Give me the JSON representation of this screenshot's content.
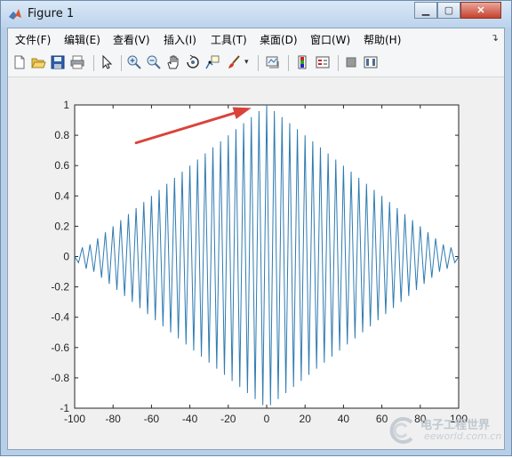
{
  "window": {
    "title": "Figure 1",
    "buttons": {
      "minimize": "▁",
      "maximize": "▢",
      "close": "✕"
    }
  },
  "menubar": {
    "items": [
      "文件(F)",
      "编辑(E)",
      "查看(V)",
      "插入(I)",
      "工具(T)",
      "桌面(D)",
      "窗口(W)",
      "帮助(H)"
    ],
    "overflow_icon": "double-chevron-icon"
  },
  "toolbar": {
    "icons": [
      "new-figure-icon",
      "open-file-icon",
      "save-icon",
      "print-icon",
      "pointer-icon",
      "zoom-in-icon",
      "zoom-out-icon",
      "pan-hand-icon",
      "rotate-3d-icon",
      "data-cursor-icon",
      "brush-icon",
      "link-plot-icon",
      "colorbar-icon",
      "legend-icon",
      "hide-plot-tools-icon",
      "show-plot-tools-icon"
    ]
  },
  "chart_data": {
    "type": "line",
    "title": "",
    "xlabel": "",
    "ylabel": "",
    "xlim": [
      -100,
      100
    ],
    "ylim": [
      -1,
      1
    ],
    "xticks": [
      "-100",
      "-80",
      "-60",
      "-40",
      "-20",
      "0",
      "20",
      "40",
      "60",
      "80",
      "100"
    ],
    "yticks": [
      "-1",
      "-0.8",
      "-0.6",
      "-0.4",
      "-0.2",
      "0",
      "0.2",
      "0.4",
      "0.6",
      "0.8",
      "1"
    ],
    "series": [
      {
        "color": "#2f7bb1",
        "points": [
          [
            -100,
            0.0
          ],
          [
            -98,
            -0.04
          ],
          [
            -96,
            0.06
          ],
          [
            -94,
            -0.08
          ],
          [
            -92,
            0.08
          ],
          [
            -90,
            -0.1
          ],
          [
            -88,
            0.12
          ],
          [
            -86,
            -0.14
          ],
          [
            -84,
            0.16
          ],
          [
            -82,
            -0.18
          ],
          [
            -80,
            0.2
          ],
          [
            -78,
            -0.22
          ],
          [
            -76,
            0.24
          ],
          [
            -74,
            -0.26
          ],
          [
            -72,
            0.28
          ],
          [
            -70,
            -0.3
          ],
          [
            -68,
            0.32
          ],
          [
            -66,
            -0.34
          ],
          [
            -64,
            0.36
          ],
          [
            -62,
            -0.38
          ],
          [
            -60,
            0.4
          ],
          [
            -58,
            -0.42
          ],
          [
            -56,
            0.44
          ],
          [
            -54,
            -0.46
          ],
          [
            -52,
            0.48
          ],
          [
            -50,
            -0.5
          ],
          [
            -48,
            0.52
          ],
          [
            -46,
            -0.54
          ],
          [
            -44,
            0.56
          ],
          [
            -42,
            -0.58
          ],
          [
            -40,
            0.6
          ],
          [
            -38,
            -0.62
          ],
          [
            -36,
            0.64
          ],
          [
            -34,
            -0.66
          ],
          [
            -32,
            0.68
          ],
          [
            -30,
            -0.7
          ],
          [
            -28,
            0.72
          ],
          [
            -26,
            -0.74
          ],
          [
            -24,
            0.76
          ],
          [
            -22,
            -0.78
          ],
          [
            -20,
            0.8
          ],
          [
            -18,
            -0.82
          ],
          [
            -16,
            0.84
          ],
          [
            -14,
            -0.86
          ],
          [
            -12,
            0.88
          ],
          [
            -10,
            -0.9
          ],
          [
            -8,
            0.92
          ],
          [
            -6,
            -0.94
          ],
          [
            -4,
            0.96
          ],
          [
            -2,
            -0.98
          ],
          [
            0,
            1.0
          ],
          [
            2,
            -0.98
          ],
          [
            4,
            0.96
          ],
          [
            6,
            -0.94
          ],
          [
            8,
            0.92
          ],
          [
            10,
            -0.9
          ],
          [
            12,
            0.88
          ],
          [
            14,
            -0.86
          ],
          [
            16,
            0.84
          ],
          [
            18,
            -0.82
          ],
          [
            20,
            0.8
          ],
          [
            22,
            -0.78
          ],
          [
            24,
            0.76
          ],
          [
            26,
            -0.74
          ],
          [
            28,
            0.72
          ],
          [
            30,
            -0.7
          ],
          [
            32,
            0.68
          ],
          [
            34,
            -0.66
          ],
          [
            36,
            0.64
          ],
          [
            38,
            -0.62
          ],
          [
            40,
            0.6
          ],
          [
            42,
            -0.58
          ],
          [
            44,
            0.56
          ],
          [
            46,
            -0.54
          ],
          [
            48,
            0.52
          ],
          [
            50,
            -0.5
          ],
          [
            52,
            0.48
          ],
          [
            54,
            -0.46
          ],
          [
            56,
            0.44
          ],
          [
            58,
            -0.42
          ],
          [
            60,
            0.4
          ],
          [
            62,
            -0.38
          ],
          [
            64,
            0.36
          ],
          [
            66,
            -0.34
          ],
          [
            68,
            0.32
          ],
          [
            70,
            -0.3
          ],
          [
            72,
            0.28
          ],
          [
            74,
            -0.26
          ],
          [
            76,
            0.24
          ],
          [
            78,
            -0.22
          ],
          [
            80,
            0.2
          ],
          [
            82,
            -0.18
          ],
          [
            84,
            0.16
          ],
          [
            86,
            -0.14
          ],
          [
            88,
            0.12
          ],
          [
            90,
            -0.1
          ],
          [
            92,
            0.08
          ],
          [
            94,
            -0.08
          ],
          [
            96,
            0.06
          ],
          [
            98,
            -0.04
          ],
          [
            100,
            0.0
          ]
        ]
      }
    ],
    "grid": false,
    "annotation": {
      "type": "arrow",
      "color": "#d9443a",
      "from": [
        -68,
        0.75
      ],
      "to": [
        -8,
        0.98
      ]
    }
  },
  "watermark": {
    "line1": "电子工程世界",
    "line2": "eeworld.com.cn"
  }
}
